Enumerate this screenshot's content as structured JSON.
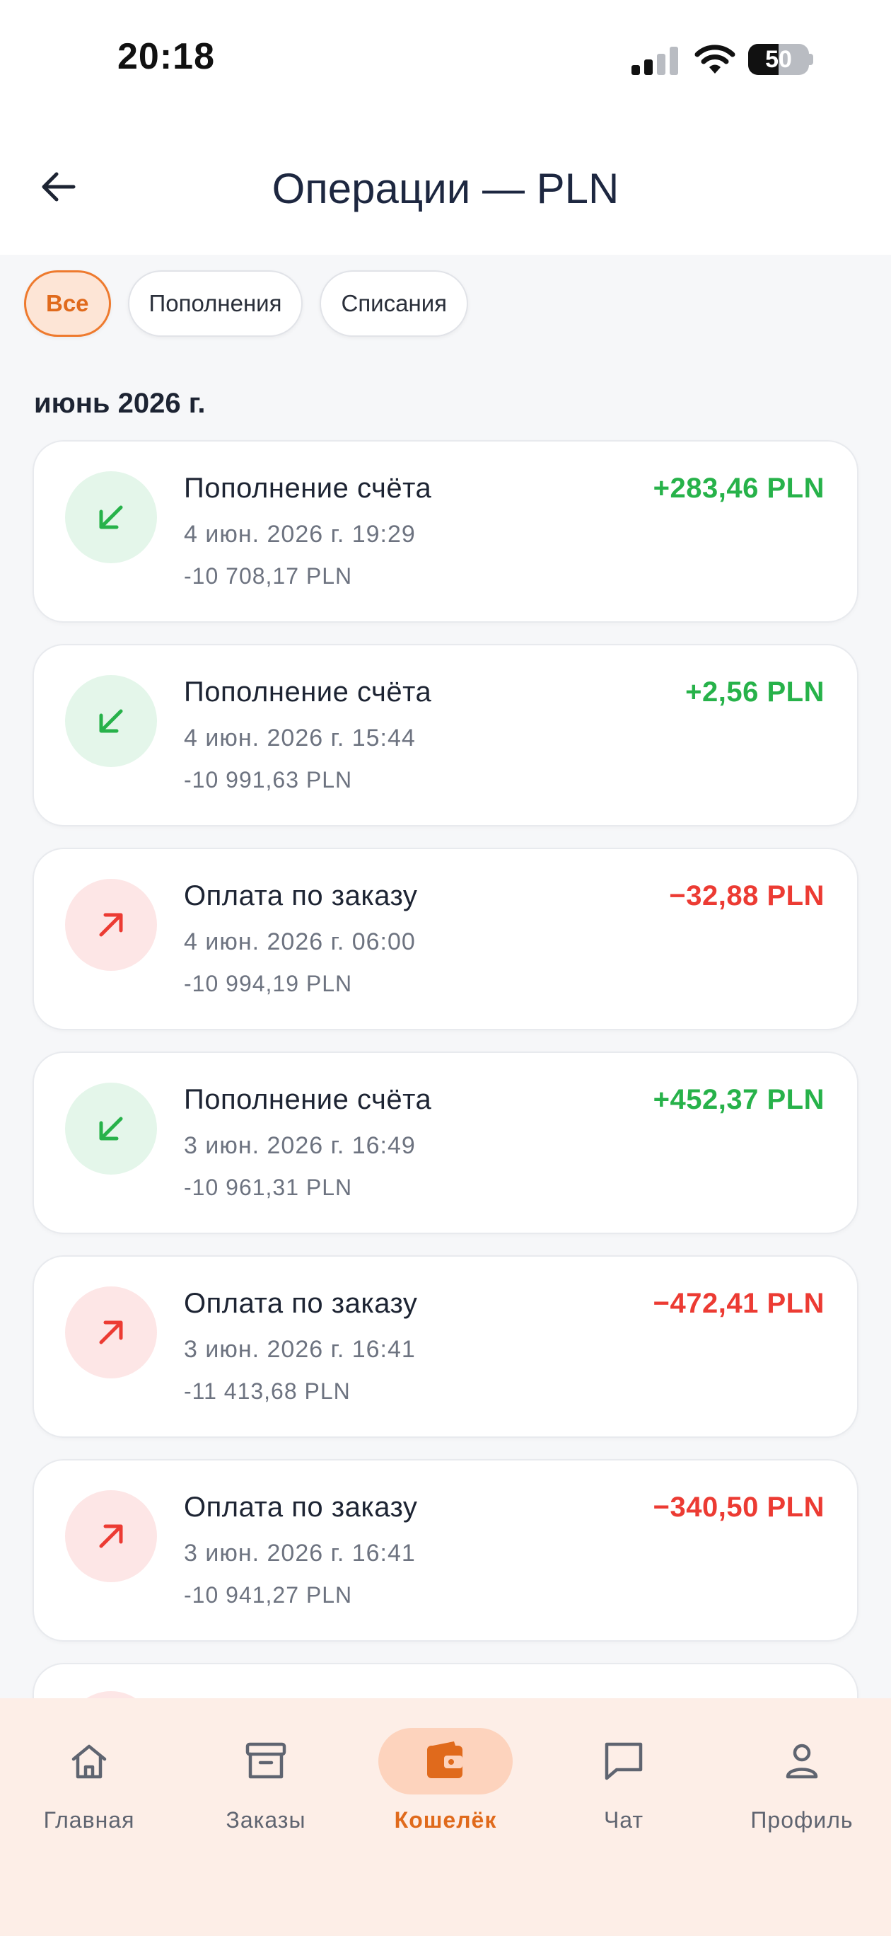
{
  "status_bar": {
    "time": "20:18",
    "battery": "50",
    "battery_level": 0.5
  },
  "header": {
    "title": "Операции — PLN",
    "back_icon": "arrow-left-icon"
  },
  "filters": [
    {
      "label": "Все",
      "active": true
    },
    {
      "label": "Пополнения",
      "active": false
    },
    {
      "label": "Списания",
      "active": false
    }
  ],
  "section": {
    "title": "июнь 2026 г."
  },
  "transactions": [
    {
      "kind": "in",
      "title": "Пополнение счёта",
      "date": "4 июн. 2026 г. 19:29",
      "balance": "-10 708,17 PLN",
      "amount": "+283,46 PLN"
    },
    {
      "kind": "in",
      "title": "Пополнение счёта",
      "date": "4 июн. 2026 г. 15:44",
      "balance": "-10 991,63 PLN",
      "amount": "+2,56 PLN"
    },
    {
      "kind": "out",
      "title": "Оплата по заказу",
      "date": "4 июн. 2026 г. 06:00",
      "balance": "-10 994,19 PLN",
      "amount": "−32,88 PLN"
    },
    {
      "kind": "in",
      "title": "Пополнение счёта",
      "date": "3 июн. 2026 г. 16:49",
      "balance": "-10 961,31 PLN",
      "amount": "+452,37 PLN"
    },
    {
      "kind": "out",
      "title": "Оплата по заказу",
      "date": "3 июн. 2026 г. 16:41",
      "balance": "-11 413,68 PLN",
      "amount": "−472,41 PLN"
    },
    {
      "kind": "out",
      "title": "Оплата по заказу",
      "date": "3 июн. 2026 г. 16:41",
      "balance": "-10 941,27 PLN",
      "amount": "−340,50 PLN"
    }
  ],
  "colors": {
    "accent": "#e06a1c",
    "income": "#27b24a",
    "expense": "#ec3b33"
  },
  "bottom_nav": [
    {
      "label": "Главная",
      "icon": "home-icon",
      "active": false
    },
    {
      "label": "Заказы",
      "icon": "archive-box-icon",
      "active": false
    },
    {
      "label": "Кошелёк",
      "icon": "wallet-icon",
      "active": true
    },
    {
      "label": "Чат",
      "icon": "chat-bubble-icon",
      "active": false
    },
    {
      "label": "Профиль",
      "icon": "user-icon",
      "active": false
    }
  ]
}
